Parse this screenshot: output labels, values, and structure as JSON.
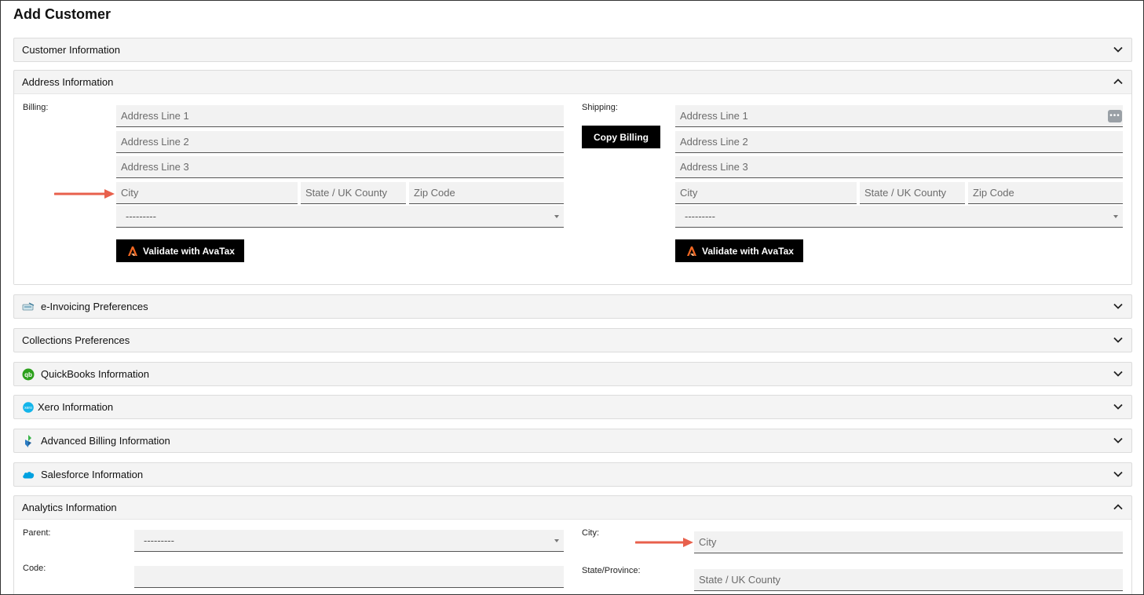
{
  "page": {
    "title": "Add Customer"
  },
  "sections": {
    "customer_info": "Customer Information",
    "address_info": "Address Information",
    "einvoicing": "e-Invoicing Preferences",
    "collections": "Collections Preferences",
    "quickbooks": "QuickBooks Information",
    "xero": "Xero Information",
    "advanced_billing": "Advanced Billing Information",
    "salesforce": "Salesforce Information",
    "analytics": "Analytics Information"
  },
  "address": {
    "billing_label": "Billing:",
    "shipping_label": "Shipping:",
    "copy_billing": "Copy Billing",
    "validate": "Validate with AvaTax",
    "placeholders": {
      "line1": "Address Line 1",
      "line2": "Address Line 2",
      "line3": "Address Line 3",
      "city": "City",
      "state": "State / UK County",
      "zip": "Zip Code"
    },
    "country_select": "---------"
  },
  "analytics": {
    "parent_label": "Parent:",
    "parent_value": "---------",
    "code_label": "Code:",
    "code_value": "",
    "city_label": "City:",
    "city_placeholder": "City",
    "state_label": "State/Province:",
    "state_placeholder": "State / UK County"
  },
  "colors": {
    "accent_arrow": "#e8604c",
    "avatax_orange": "#f26722",
    "quickbooks_green": "#2ca01c",
    "xero_blue": "#13b5ea",
    "salesforce_blue": "#00a1e0"
  }
}
